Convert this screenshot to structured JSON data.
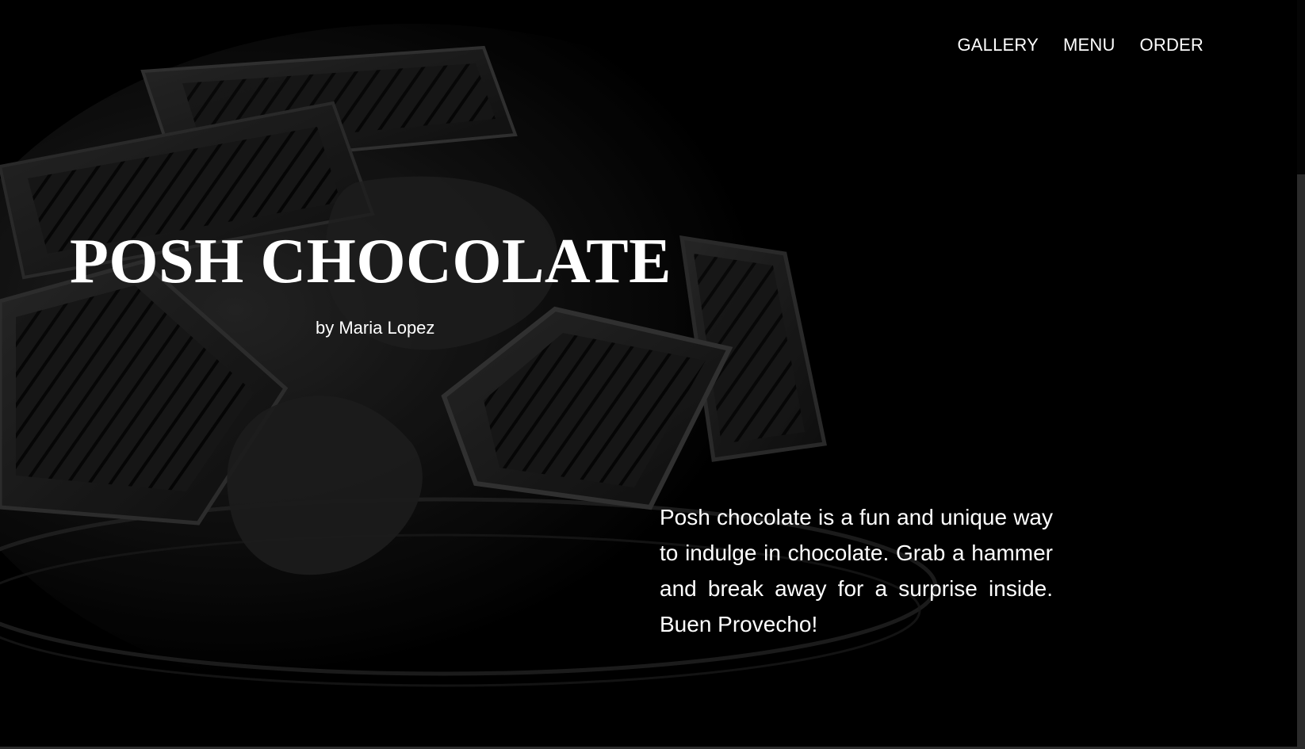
{
  "nav": {
    "items": [
      {
        "label": "GALLERY"
      },
      {
        "label": "MENU"
      },
      {
        "label": "ORDER"
      }
    ]
  },
  "hero": {
    "title": "POSH CHOCOLATE",
    "byline": "by Maria Lopez",
    "description": "Posh chocolate is a fun and unique way to indulge in chocolate. Grab a hammer and break away for a surprise inside. Buen Provecho!"
  },
  "colors": {
    "background": "#000000",
    "text": "#ffffff"
  },
  "icons": {
    "hero_image": "chocolate-bars-image"
  }
}
